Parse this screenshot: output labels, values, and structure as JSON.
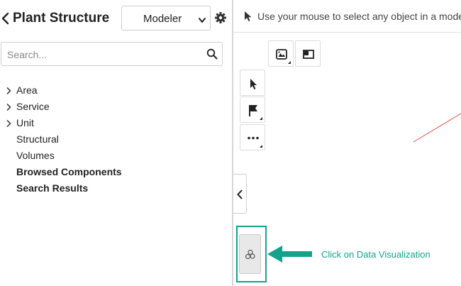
{
  "panel": {
    "title": "Plant Structure",
    "mode_value": "Modeler",
    "mode_options": [
      "Modeler"
    ]
  },
  "search": {
    "placeholder": "Search..."
  },
  "tree": {
    "items": [
      {
        "label": "Area",
        "expandable": true,
        "bold": false
      },
      {
        "label": "Service",
        "expandable": true,
        "bold": false
      },
      {
        "label": "Unit",
        "expandable": true,
        "bold": false
      },
      {
        "label": "Structural",
        "expandable": false,
        "bold": false
      },
      {
        "label": "Volumes",
        "expandable": false,
        "bold": false
      },
      {
        "label": "Browsed Components",
        "expandable": false,
        "bold": true
      },
      {
        "label": "Search Results",
        "expandable": false,
        "bold": true
      }
    ]
  },
  "viewer": {
    "status_message": "Use your mouse to select any object in a model"
  },
  "toolbar": {
    "icons": [
      "view-cube-icon",
      "window-layout-icon",
      "select-pointer-icon",
      "flag-icon",
      "more-options-icon",
      "collapse-chevron-icon",
      "data-visualization-icon"
    ]
  },
  "annotation": {
    "text": "Click on Data Visualization",
    "color": "#13a38a"
  },
  "colors": {
    "accent": "#13a38a",
    "model_line": "#e05050"
  }
}
